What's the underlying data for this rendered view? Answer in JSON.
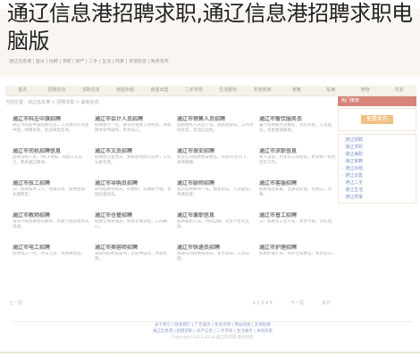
{
  "title": "通辽信息港招聘求职,通辽信息港招聘求职电脑版",
  "top_links": "通辽信息港 | 首页 | 招聘 | 求职 | 房产 | 二手 | 生活 | 商家 | 本地信息 | 免费发布",
  "nav": [
    "首页",
    "招聘信息",
    "求职信息",
    "房屋出租",
    "房屋出售",
    "二手市场",
    "生活服务",
    "本地商家",
    "家教",
    "车辆",
    "宠物",
    "交友"
  ],
  "path": "当前位置：通辽信息港 > 招聘求职 > 最新信息",
  "right": {
    "header": "热门推荐",
    "button": "免费发布",
    "list": [
      "· 通辽招聘",
      "· 通辽求职",
      "· 通辽兼职",
      "· 通辽家教",
      "· 通辽出租",
      "· 通辽出售",
      "· 通辽二手",
      "· 通辽生活",
      "· 通辽商家"
    ]
  },
  "cards": [
    {
      "h": "通辽市科左中旗招聘",
      "b": "通辽市科左中旗招聘信息，工作地点在科左中旗，待遇优厚，欢迎来电咨询。"
    },
    {
      "h": "通辽市会计人员招聘",
      "b": "招聘会计一名，要求有相关工作经验，熟悉财务软件操作，有责任心。"
    },
    {
      "h": "通辽市销售人员招聘",
      "b": "诚聘销售人员若干名，底薪加提成，工作时间灵活，欢迎应届生。"
    },
    {
      "h": "通辽市餐饮服务员",
      "b": "餐厅招聘服务员数名，包吃包住，工资面议，有意者请联系。"
    },
    {
      "h": "通辽市司机招聘信息",
      "b": "招聘司机一名，持C1驾照，驾龄三年以上，熟悉通辽路线。"
    },
    {
      "h": "通辽市文员招聘",
      "b": "招聘办公室文员，熟练使用办公软件，工作认真负责。"
    },
    {
      "h": "通辽市保安招聘",
      "b": "物业公司招聘保安数名，年龄45岁以下，身体健康。"
    },
    {
      "h": "通辽市求职信息",
      "b": "本人求职，有多年工作经验，希望找一份稳定的工作。"
    },
    {
      "h": "通辽市技工招聘",
      "b": "工厂招聘技术工人，待遇从优，提供住宿，长期稳定。"
    },
    {
      "h": "通辽市导购员招聘",
      "b": "商场招聘导购员，形象好，沟通能力强，有经验者优先。"
    },
    {
      "h": "通辽市厨师招聘",
      "b": "饭店招聘厨师一名，擅长炒菜，工资面议，待遇优厚。"
    },
    {
      "h": "通辽市客服招聘",
      "b": "招聘电话客服，普通话标准，有耐心，双休。"
    },
    {
      "h": "通辽市教师招聘",
      "b": "培训学校招聘各科教师，有教学经验者优先考虑。"
    },
    {
      "h": "通辽市仓管招聘",
      "b": "招聘仓库管理员，熟悉仓储流程，工作细心。"
    },
    {
      "h": "通辽市兼职信息",
      "b": "招聘兼职人员，时间自由，适合学生及宝妈。"
    },
    {
      "h": "通辽市普工招聘",
      "b": "工厂招聘普工若干名，男女不限，包吃住。"
    },
    {
      "h": "通辽市电工招聘",
      "b": "招聘电工一名，持证上岗，有相关经验。"
    },
    {
      "h": "通辽市美容师招聘",
      "b": "美容院招聘美容师，可提供培训，待遇优厚。"
    },
    {
      "h": "通辽市快递员招聘",
      "b": "快递公司招聘快递员，多劳多得，工资日结。"
    },
    {
      "h": "通辽市护理招聘",
      "b": "招聘护理人员，有护士资格证，有责任心。"
    }
  ],
  "pager": {
    "prev": "上一页",
    "pages": "1 2 3 4 5",
    "next": "下一页",
    "total": "共计"
  },
  "footer": {
    "row1": "关于我们 | 联系我们 | 广告服务 | 免责声明 | 网站地图 | 友情链接",
    "row2": "通辽信息港 | 招聘求职 | 房产信息 | 二手市场 | 生活服务 | 本地商家",
    "row3": "Copyright 2013-2014 通辽信息港 版权所有"
  }
}
